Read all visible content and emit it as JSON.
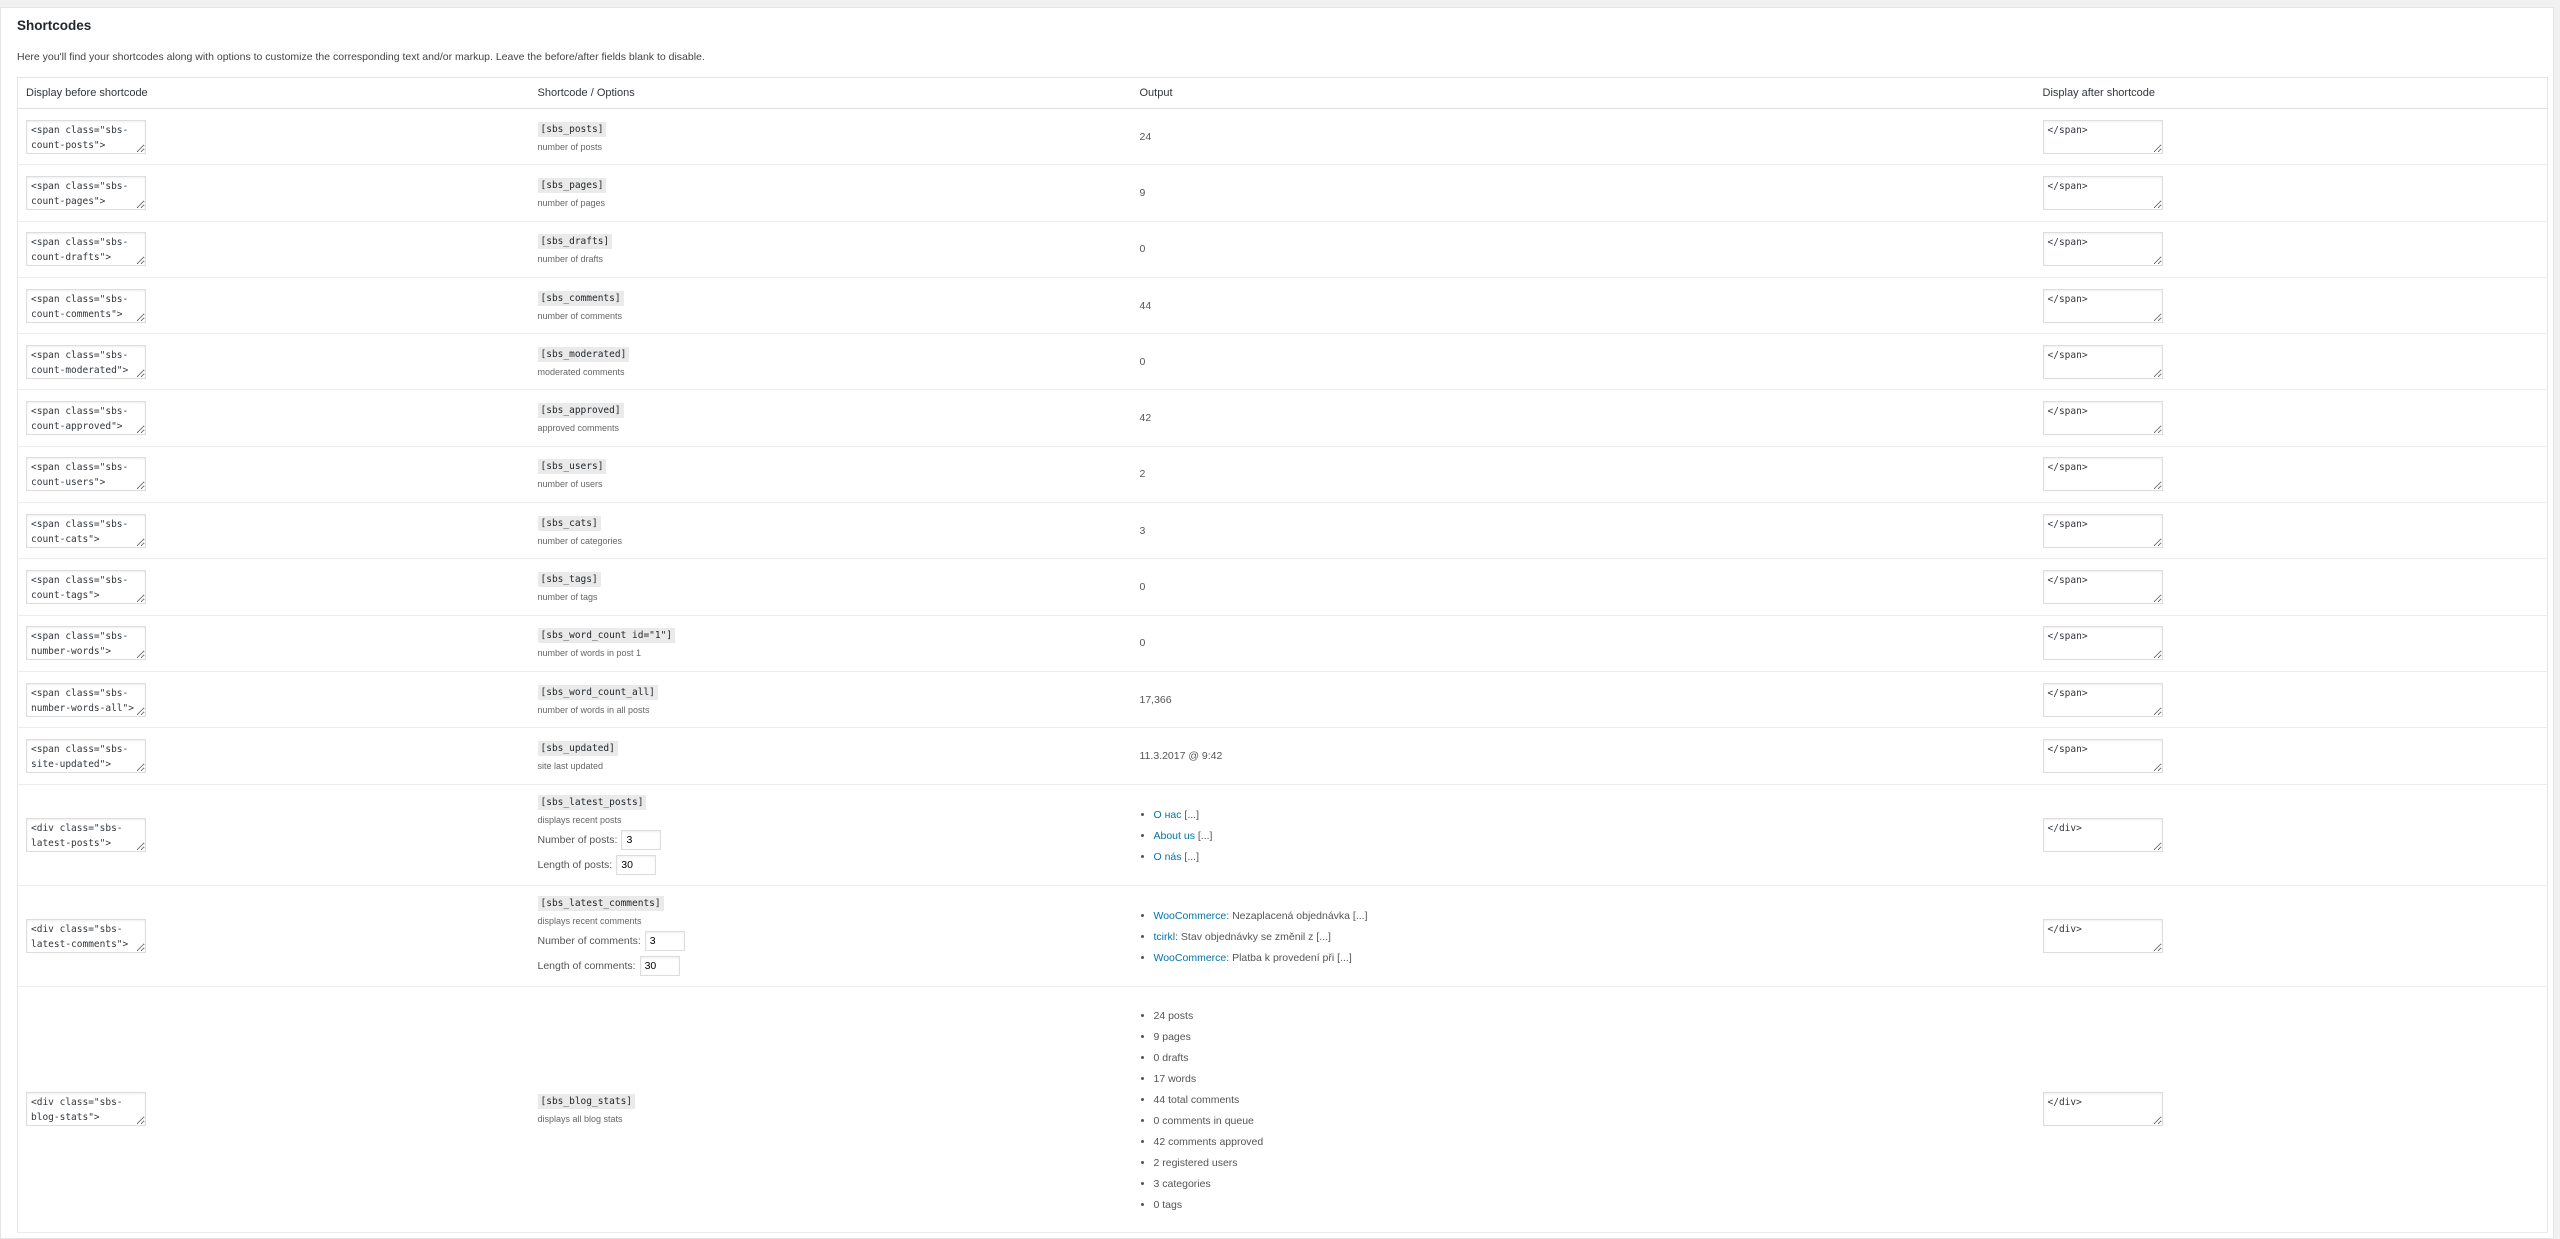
{
  "page": {
    "title": "Shortcodes",
    "intro": "Here you'll find your shortcodes along with options to customize the corresponding text and/or markup. Leave the before/after fields blank to disable."
  },
  "table": {
    "headers": [
      "Display before shortcode",
      "Shortcode / Options",
      "Output",
      "Display after shortcode"
    ],
    "rows": [
      {
        "before": "<span class=\"sbs-count-posts\">",
        "shortcode": "[sbs_posts]",
        "desc": "number of posts",
        "output": "24",
        "after": "</span>"
      },
      {
        "before": "<span class=\"sbs-count-pages\">",
        "shortcode": "[sbs_pages]",
        "desc": "number of pages",
        "output": "9",
        "after": "</span>"
      },
      {
        "before": "<span class=\"sbs-count-drafts\">",
        "shortcode": "[sbs_drafts]",
        "desc": "number of drafts",
        "output": "0",
        "after": "</span>"
      },
      {
        "before": "<span class=\"sbs-count-comments\">",
        "shortcode": "[sbs_comments]",
        "desc": "number of comments",
        "output": "44",
        "after": "</span>"
      },
      {
        "before": "<span class=\"sbs-count-moderated\">",
        "shortcode": "[sbs_moderated]",
        "desc": "moderated comments",
        "output": "0",
        "after": "</span>"
      },
      {
        "before": "<span class=\"sbs-count-approved\">",
        "shortcode": "[sbs_approved]",
        "desc": "approved comments",
        "output": "42",
        "after": "</span>"
      },
      {
        "before": "<span class=\"sbs-count-users\">",
        "shortcode": "[sbs_users]",
        "desc": "number of users",
        "output": "2",
        "after": "</span>"
      },
      {
        "before": "<span class=\"sbs-count-cats\">",
        "shortcode": "[sbs_cats]",
        "desc": "number of categories",
        "output": "3",
        "after": "</span>"
      },
      {
        "before": "<span class=\"sbs-count-tags\">",
        "shortcode": "[sbs_tags]",
        "desc": "number of tags",
        "output": "0",
        "after": "</span>"
      },
      {
        "before": "<span class=\"sbs-number-words\">",
        "shortcode": "[sbs_word_count id=\"1\"]",
        "desc": "number of words in post 1",
        "output": "0",
        "after": "</span>"
      },
      {
        "before": "<span class=\"sbs-number-words-all\">",
        "shortcode": "[sbs_word_count_all]",
        "desc": "number of words in all posts",
        "output": "17,366",
        "after": "</span>"
      },
      {
        "before": "<span class=\"sbs-site-updated\">",
        "shortcode": "[sbs_updated]",
        "desc": "site last updated",
        "output": "11.3.2017 @ 9:42",
        "after": "</span>"
      }
    ],
    "latest_posts": {
      "before": "<div class=\"sbs-latest-posts\">",
      "shortcode": "[sbs_latest_posts]",
      "desc": "displays recent posts",
      "num_label": "Number of posts:",
      "num_value": "3",
      "len_label": "Length of posts:",
      "len_value": "30",
      "items": [
        {
          "link": "О нас",
          "rest": " [...]"
        },
        {
          "link": "About us",
          "rest": " [...]"
        },
        {
          "link": "O nás",
          "rest": " [...]"
        }
      ],
      "after": "</div>"
    },
    "latest_comments": {
      "before": "<div class=\"sbs-latest-comments\">",
      "shortcode": "[sbs_latest_comments]",
      "desc": "displays recent comments",
      "num_label": "Number of comments:",
      "num_value": "3",
      "len_label": "Length of comments:",
      "len_value": "30",
      "items": [
        {
          "link": "WooCommerce",
          "rest": ": Nezaplacená objednávka [...]"
        },
        {
          "link": "tcirkl",
          "rest": ": Stav objednávky se změnil z [...]"
        },
        {
          "link": "WooCommerce",
          "rest": ": Platba k provedení při [...]"
        }
      ],
      "after": "</div>"
    },
    "blog_stats": {
      "before": "<div class=\"sbs-blog-stats\">",
      "shortcode": "[sbs_blog_stats]",
      "desc": "displays all blog stats",
      "items": [
        "24 posts",
        "9 pages",
        "0 drafts",
        "17 words",
        "44 total comments",
        "0 comments in queue",
        "42 comments approved",
        "2 registered users",
        "3 categories",
        "0 tags"
      ],
      "after": "</div>"
    }
  }
}
